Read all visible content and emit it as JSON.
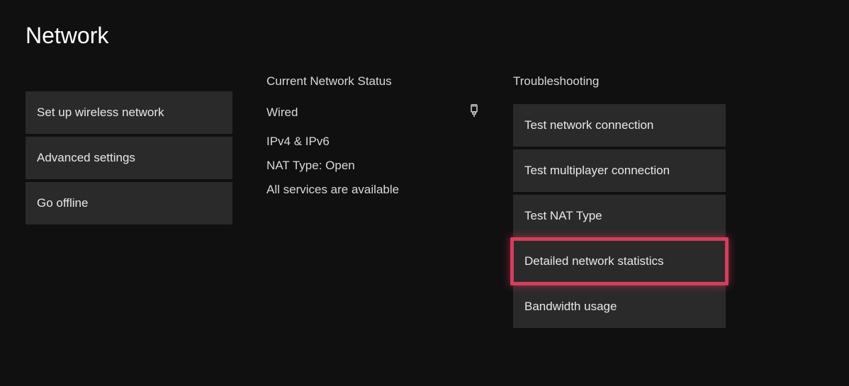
{
  "page_title": "Network",
  "left_menu": {
    "items": [
      {
        "label": "Set up wireless network"
      },
      {
        "label": "Advanced settings"
      },
      {
        "label": "Go offline"
      }
    ]
  },
  "status": {
    "header": "Current Network Status",
    "connection_type": "Wired",
    "connection_icon": "wired-plug-icon",
    "lines": [
      "IPv4 & IPv6",
      "NAT Type: Open",
      "All services are available"
    ]
  },
  "troubleshooting": {
    "header": "Troubleshooting",
    "items": [
      {
        "label": "Test network connection",
        "highlighted": false
      },
      {
        "label": "Test multiplayer connection",
        "highlighted": false
      },
      {
        "label": "Test NAT Type",
        "highlighted": false
      },
      {
        "label": "Detailed network statistics",
        "highlighted": true
      },
      {
        "label": "Bandwidth usage",
        "highlighted": false
      }
    ]
  }
}
